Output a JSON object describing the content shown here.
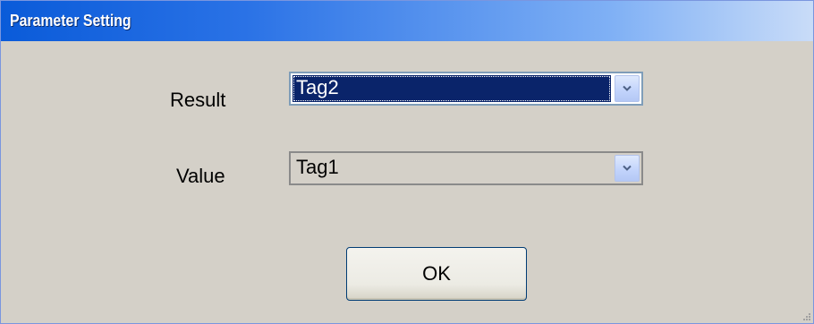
{
  "window": {
    "title": "Parameter Setting"
  },
  "fields": {
    "result": {
      "label": "Result",
      "selected": "Tag2"
    },
    "value": {
      "label": "Value",
      "selected": "Tag1"
    }
  },
  "buttons": {
    "ok_label": "OK"
  },
  "icons": {
    "dropdown": "chevron-down-icon",
    "resize": "resize-grip-icon"
  },
  "colors": {
    "title_bar": "#0a5bd9",
    "selection": "#0a246a",
    "dialog_bg": "#d4d0c8"
  }
}
